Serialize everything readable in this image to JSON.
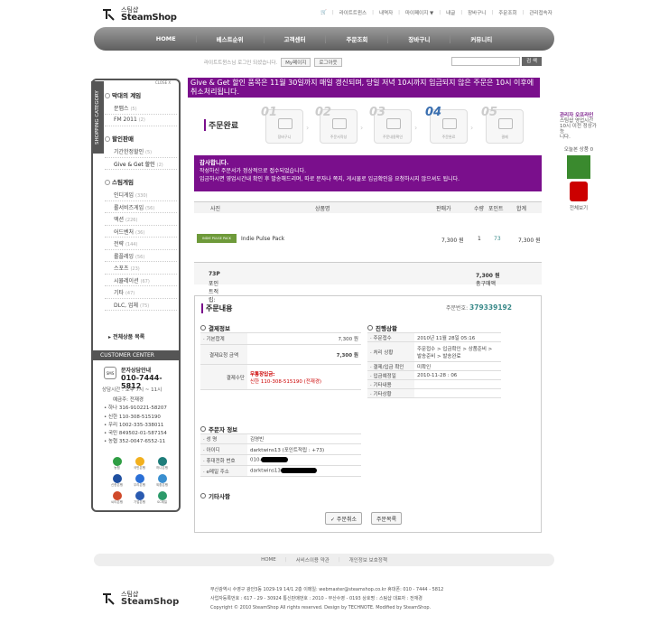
{
  "header": {
    "logo_kr": "스팀샵",
    "logo_en": "SteamShop",
    "top_links": [
      "라이트트윈스",
      "내역자",
      "마이페이지 ▼",
      "내글",
      "장바구니",
      "주문조회",
      "관리접속자"
    ],
    "nav": [
      "HOME",
      "베스트순위",
      "고객센터",
      "주문조회",
      "장바구니",
      "커뮤니티"
    ],
    "login_text": "라이트트윈스님 로그인 되셨습니다.",
    "login_btn1": "My페이지",
    "login_btn2": "로그아웃",
    "search_btn": "검 색"
  },
  "sidebar": {
    "tab_label": "SHOPPING CATEGORY",
    "close": "CLOSE X",
    "groups": [
      {
        "head": "막대의 계임",
        "items": [
          {
            "label": "문맵스",
            "n": "(5)"
          },
          {
            "label": "FM 2011",
            "n": "(2)"
          }
        ]
      },
      {
        "head": "할인판매",
        "items": [
          {
            "label": "기간한정할인",
            "n": "(5)"
          },
          {
            "label": "Give & Get 할인",
            "n": "(2)"
          }
        ]
      },
      {
        "head": "스팀게임",
        "items": [
          {
            "label": "인디게임",
            "n": "(330)"
          },
          {
            "label": "롤서비즈게임",
            "n": "(56)"
          },
          {
            "label": "액션",
            "n": "(226)"
          },
          {
            "label": "어드벤처",
            "n": "(36)"
          },
          {
            "label": "전략",
            "n": "(144)"
          },
          {
            "label": "롤플레잉",
            "n": "(56)"
          },
          {
            "label": "스포츠",
            "n": "(23)"
          },
          {
            "label": "시뮬레이션",
            "n": "(67)"
          },
          {
            "label": "기타",
            "n": "(47)"
          },
          {
            "label": "DLC, 업체",
            "n": "(75)"
          }
        ]
      }
    ],
    "all_categories": "전체상품 목록"
  },
  "cs": {
    "bar": "CUSTOMER CENTER",
    "icon_text": "SMS",
    "line1": "문자상담안내",
    "phone": "010-7444-5812",
    "hours": "상담시간 : 오후 7시 ~ 11시",
    "accounts_title": "예금주: 전재경",
    "accounts": [
      "• 하나 316-910221-58207",
      "• 신한 110-308-515190",
      "• 우리 1002-335-338011",
      "• 국민 849502-01-587154",
      "• 농협 352-0047-6552-11"
    ],
    "banks": [
      {
        "label": "농협",
        "color": "#2f9e44"
      },
      {
        "label": "국민은행",
        "color": "#f2b01e"
      },
      {
        "label": "하나은행",
        "color": "#1e7d7a"
      },
      {
        "label": "신한은행",
        "color": "#1f4fa0"
      },
      {
        "label": "우리은행",
        "color": "#2a6fd6"
      },
      {
        "label": "외환은행",
        "color": "#3a8fd0"
      },
      {
        "label": "씨티은행",
        "color": "#d04a2a"
      },
      {
        "label": "기업은행",
        "color": "#2a5ab0"
      },
      {
        "label": "SC제일",
        "color": "#2c9a6a"
      }
    ]
  },
  "quick": {
    "title_lines": [
      "관리자 오프라인",
      "스팀샵 영업시간",
      "10시 이전 정상가능",
      "니다."
    ],
    "compare": "오늘본 상품 0",
    "all": "전체보기"
  },
  "banner": "Give & Get 할인 품목은 11월 30일까지 매일 갱신되며, 당일 저녁 10시까지 입금되지 않은 주문은 10시 이후에 취소처리됩니다.",
  "steps": {
    "title": "주문완료",
    "items": [
      {
        "num": "01",
        "label": "장바구니"
      },
      {
        "num": "02",
        "label": "주문서작성"
      },
      {
        "num": "03",
        "label": "주문내용확인"
      },
      {
        "num": "04",
        "label": "주문완료"
      },
      {
        "num": "05",
        "label": "결제"
      }
    ]
  },
  "thanks": {
    "line1": "감사합니다.",
    "line2": "작성하신 주문서가 정상적으로 접수되었습니다.",
    "line3": "입금하시면 영업시간내 확인 후 발송해드리며, 따로 문자나 쪽지, 게시물로 입금확인을 요청하시지 않으셔도 됩니다."
  },
  "order_table": {
    "headers": [
      "사진",
      "상품명",
      "판매가",
      "수량",
      "포인트",
      "합계"
    ],
    "row": {
      "thumb": "INDIE PULSE PACK",
      "name": "Indie Pulse Pack",
      "price": "7,300 원",
      "qty": "1",
      "point": "73",
      "total": "7,300 원"
    },
    "points_label": "포인트적립:",
    "points_value": "73P",
    "total_label": "총구매액",
    "total_value": "7,300 원"
  },
  "detail": {
    "title": "주문내용",
    "order_no_label": "주문번호:",
    "order_no": "379339192",
    "payment": {
      "title": "결제정보",
      "rows": [
        {
          "k": "· 기본합계",
          "v": "7,300 원"
        },
        {
          "k": "결제요청 금액",
          "v": "7,300 원"
        },
        {
          "k": "결제수단",
          "v1": "무통장입금:",
          "v2": "신한 110-308-515190 (전재경)"
        }
      ]
    },
    "progress": {
      "title": "진행상황",
      "rows": [
        {
          "k": "· 주문접수",
          "v": "2010년 11월 28일 05:16"
        },
        {
          "k": "· 처리 상황",
          "v": "주문접수 > 입금확인 > 상품준비 > 발송준비 > 발송완료"
        },
        {
          "k": "· 결제/입금 확인",
          "v": "미확인"
        },
        {
          "k": "· 입금예정일",
          "v": "2010-11-28 : 06"
        },
        {
          "k": "· 기타내용",
          "v": ""
        },
        {
          "k": "· 기타상황",
          "v": ""
        }
      ]
    },
    "orderer": {
      "title": "주문자 정보",
      "rows": [
        {
          "k": "· 성 명",
          "v": "김영빈"
        },
        {
          "k": "· 아이디",
          "v": "darktwins13 (포인트적립 : +73)"
        },
        {
          "k": "· 휴대전화 번호",
          "v": "010-"
        },
        {
          "k": "· e메일 주소",
          "v": "darktwins13"
        }
      ]
    },
    "etc_title": "기타사항",
    "btn_cancel": "✓ 주문취소",
    "btn_list": "주문목록"
  },
  "footer": {
    "nav": [
      "HOME",
      "서비스이용 약관",
      "개인정보 보호정책"
    ],
    "lines": [
      "부산광역시 수영구 광안3동 1029-19 14/1 2층   이메일: webmaster@steamshop.co.kr   휴대폰: 010 - 7444 - 5812",
      "사업자등록번호 : 617 - 29 - 30924    통신판매번호 : 2010 - 부산수영 - 0193    상호명 : 스팀샵    대표자 : 전재경",
      "Copyright © 2010 SteamShop All rights reserved. Design by TECHNOTE. Modified by SteamShop."
    ]
  }
}
